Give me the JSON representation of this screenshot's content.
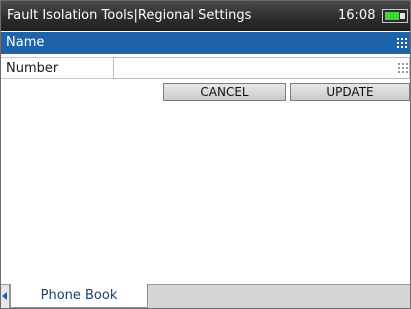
{
  "window": {
    "title": "Fault Isolation Tools|Regional Settings",
    "clock": "16:08",
    "battery_icon": "battery-charging-icon"
  },
  "form": {
    "rows": [
      {
        "label": "Name",
        "value": "",
        "selected": true
      },
      {
        "label": "Number",
        "value": "",
        "selected": false
      }
    ]
  },
  "buttons": {
    "cancel_label": "CANCEL",
    "update_label": "UPDATE"
  },
  "tabs": [
    {
      "label": "Phone Book",
      "active": true
    }
  ],
  "colors": {
    "accent": "#1e63a7",
    "titlebar": "#2c2c2c",
    "battery": "#3fd33f"
  }
}
